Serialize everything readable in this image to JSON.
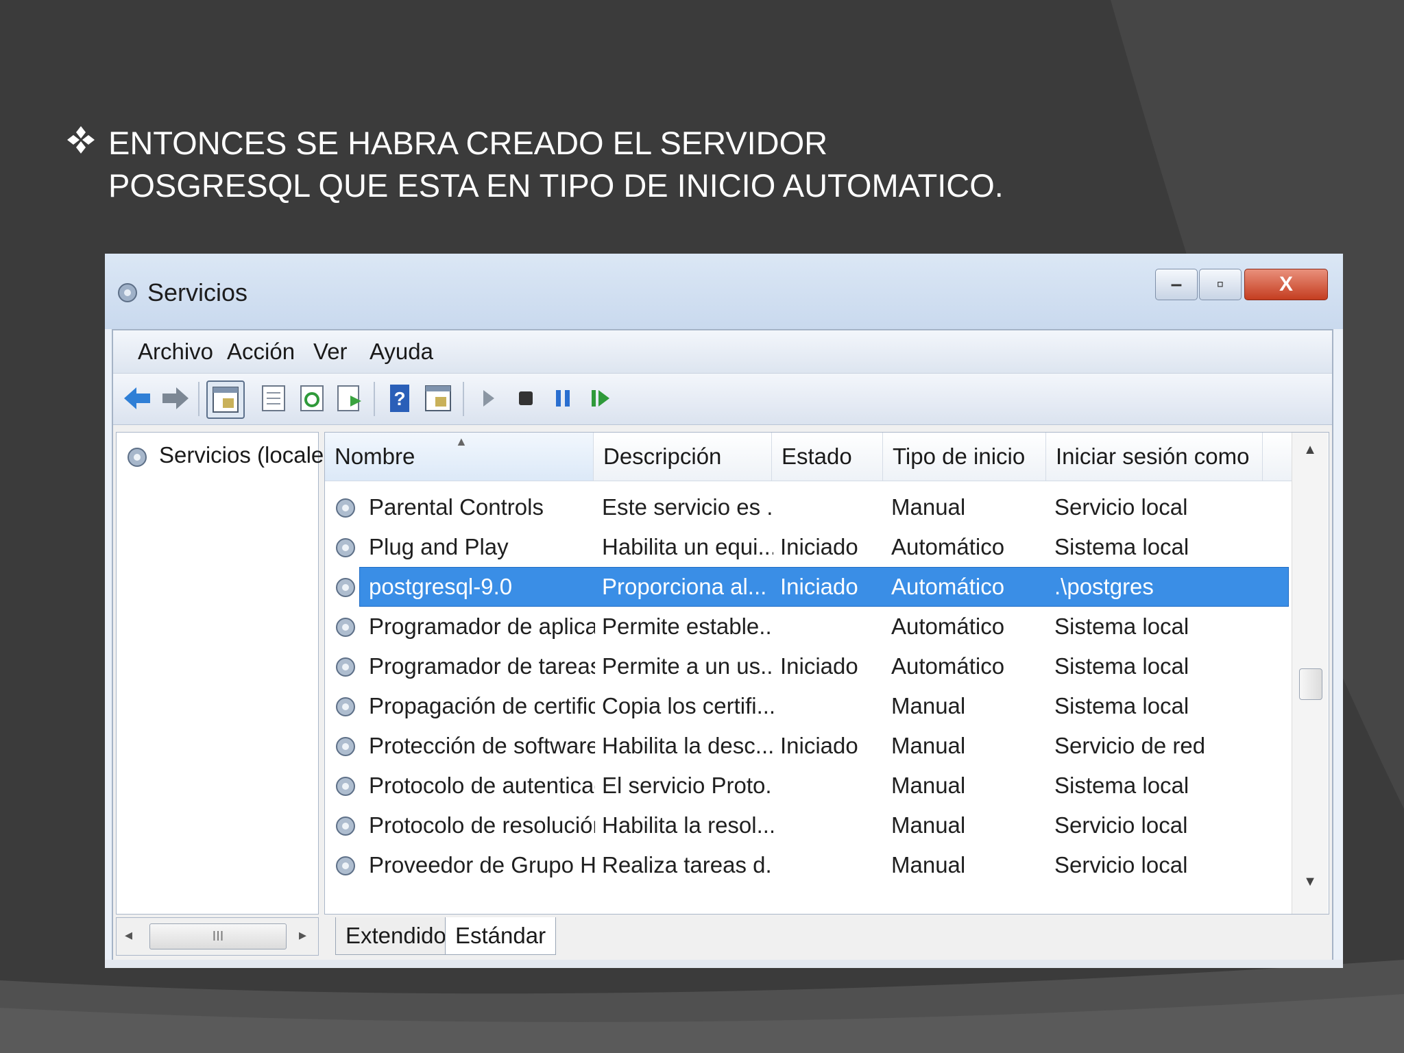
{
  "slide": {
    "bullet_text": "ENTONCES SE HABRA CREADO EL SERVIDOR\nPOSGRESQL QUE ESTA EN TIPO DE INICIO AUTOMATICO.",
    "bullet_icon": "four-diamond-bullet-icon",
    "background_color": "#3b3b3b",
    "text_color": "#ffffff"
  },
  "window": {
    "title": "Servicios",
    "controls": {
      "minimize": "–",
      "maximize": "▫",
      "close": "X"
    },
    "menu": [
      "Archivo",
      "Acción",
      "Ver",
      "Ayuda"
    ],
    "toolbar_icons": [
      "back-arrow-icon",
      "forward-arrow-icon",
      "console-tree-icon",
      "properties-icon",
      "refresh-icon",
      "export-list-icon",
      "help-icon",
      "view-icon",
      "start-service-icon",
      "stop-service-icon",
      "pause-service-icon",
      "resume-service-icon"
    ],
    "tree": {
      "root": "Servicios (locales)"
    },
    "list": {
      "columns": [
        "Nombre",
        "Descripción",
        "Estado",
        "Tipo de inicio",
        "Iniciar sesión como"
      ],
      "rows": [
        {
          "name": "Parental Controls",
          "desc": "Este servicio es ...",
          "state": "",
          "startup": "Manual",
          "logon": "Servicio local"
        },
        {
          "name": "Plug and Play",
          "desc": "Habilita un equi...",
          "state": "Iniciado",
          "startup": "Automático",
          "logon": "Sistema local"
        },
        {
          "name": "postgresql-9.0",
          "desc": "Proporciona al...",
          "state": "Iniciado",
          "startup": "Automático",
          "logon": ".\\postgres",
          "selected": true
        },
        {
          "name": "Programador de aplicac...",
          "desc": "Permite estable...",
          "state": "",
          "startup": "Automático",
          "logon": "Sistema local"
        },
        {
          "name": "Programador de tareas",
          "desc": "Permite a un us...",
          "state": "Iniciado",
          "startup": "Automático",
          "logon": "Sistema local"
        },
        {
          "name": "Propagación de certific...",
          "desc": "Copia los certifi...",
          "state": "",
          "startup": "Manual",
          "logon": "Sistema local"
        },
        {
          "name": "Protección de software",
          "desc": "Habilita la desc...",
          "state": "Iniciado",
          "startup": "Manual",
          "logon": "Servicio de red"
        },
        {
          "name": "Protocolo de autenticac...",
          "desc": "El servicio Proto...",
          "state": "",
          "startup": "Manual",
          "logon": "Sistema local"
        },
        {
          "name": "Protocolo de resolución...",
          "desc": "Habilita la resol...",
          "state": "",
          "startup": "Manual",
          "logon": "Servicio local"
        },
        {
          "name": "Proveedor de Grupo Ho...",
          "desc": "Realiza tareas d...",
          "state": "",
          "startup": "Manual",
          "logon": "Servicio local"
        }
      ]
    },
    "tabs": [
      "Extendido",
      "Estándar"
    ],
    "left_scroll_thumb": "III",
    "selection_color": "#3a8ee6"
  }
}
